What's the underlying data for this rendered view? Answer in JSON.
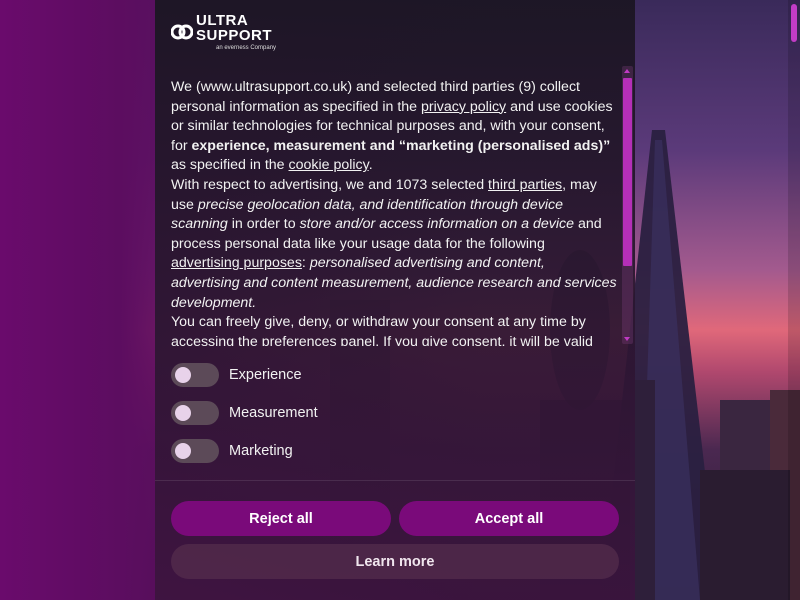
{
  "brand": {
    "line1": "ULTRA",
    "line2": "SUPPORT",
    "tagline": "an everness Company"
  },
  "consent_text": {
    "p1_a": "We (www.ultrasupport.co.uk) and selected third parties (9) collect personal information as specified in the ",
    "privacy_link": "privacy policy",
    "p1_b": " and use cookies or similar technologies for technical purposes and, with your consent, for ",
    "p1_bold": "experience, measurement and “marketing (personalised ads)”",
    "p1_c": " as specified in the ",
    "cookie_link": "cookie policy",
    "p1_d": ".",
    "p2_a": "With respect to advertising, we and 1073 selected ",
    "third_parties_link": "third parties",
    "p2_b": ", may use ",
    "p2_i1": "precise geolocation data, and identification through device scanning",
    "p2_c": " in order to ",
    "p2_i2": "store and/or access information on a device",
    "p2_d": " and process personal data like your usage data for the following ",
    "advertising_link": "advertising purposes",
    "p2_e": ": ",
    "p2_i3": "personalised advertising and content, advertising and content measurement, audience research and services development.",
    "p3": "You can freely give, deny, or withdraw your consent at any time by accessing the preferences panel. If you give consent, it will be valid"
  },
  "toggles": [
    {
      "label": "Experience",
      "on": false
    },
    {
      "label": "Measurement",
      "on": false
    },
    {
      "label": "Marketing",
      "on": false
    }
  ],
  "buttons": {
    "reject": "Reject all",
    "accept": "Accept all",
    "learn_more": "Learn more"
  },
  "colors": {
    "accent": "#7a0a7a",
    "scroll_thumb": "#b52fb8",
    "modal_bg": "#1c1624"
  }
}
